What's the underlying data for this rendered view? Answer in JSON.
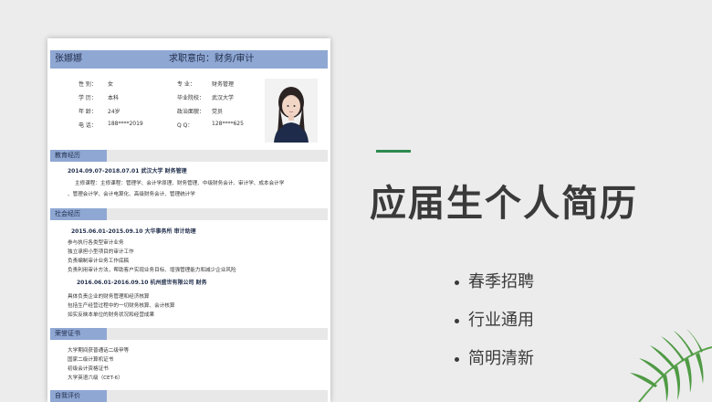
{
  "resume": {
    "name": "张娜娜",
    "intent": "求职意向：财务/审计",
    "info": {
      "gender_label": "性 别：",
      "gender": "女",
      "edu_label": "学 历：",
      "edu": "本科",
      "age_label": "年 龄：",
      "age": "24岁",
      "phone_label": "电 话：",
      "phone": "188****2019",
      "major_label": "专 业：",
      "major": "财务管理",
      "school_label": "毕业院校：",
      "school": "武汉大学",
      "politics_label": "政治面貌：",
      "politics": "党员",
      "qq_label": "Q Q：",
      "qq": "128****625"
    },
    "education": {
      "heading": "教育经历",
      "line1": "2014.09.07-2018.07.01    武汉大学        财务管理",
      "line2": "主修课程：主修课程：管理学、会计学原理、财务管理、中级财务会计、审计学、成本会计学",
      "line3": "、管理会计学、会计电算化、高级财务会计、管理统计学"
    },
    "social": {
      "heading": "社会经历",
      "job1": "2015.06.01-2015.09.10       大华事务所         审计助理",
      "d1": "参与执行各类型审计业务",
      "d2": "独立承担小型项目的审计工作",
      "d3": "负责编制审计业务工作底稿",
      "d4": "负责利用审计方法，帮助客户实现业务目标、增强管理能力和减少企业风险",
      "job2": "2016.06.01-2016.09.10       杭州盛世有限公司         财务",
      "d5": "具体负责企业的财务管理和经济核算",
      "d6": "包括生产经营过程中的一切财务核算、会计核算",
      "d7": "如实反映本单位的财务状况和经营成果"
    },
    "honors": {
      "heading": "荣誉证书",
      "c1": "大学期间获普通话二级甲等",
      "c2": "国家二级计算机证书",
      "c3": "初级会计资格证书",
      "c4": "大学英语六级（CET-6）"
    },
    "self": {
      "heading": "自我评价"
    }
  },
  "promo": {
    "title": "应届生个人简历",
    "bullets": [
      "春季招聘",
      "行业通用",
      "简明清新"
    ],
    "accent_color": "#2d8a4e"
  }
}
